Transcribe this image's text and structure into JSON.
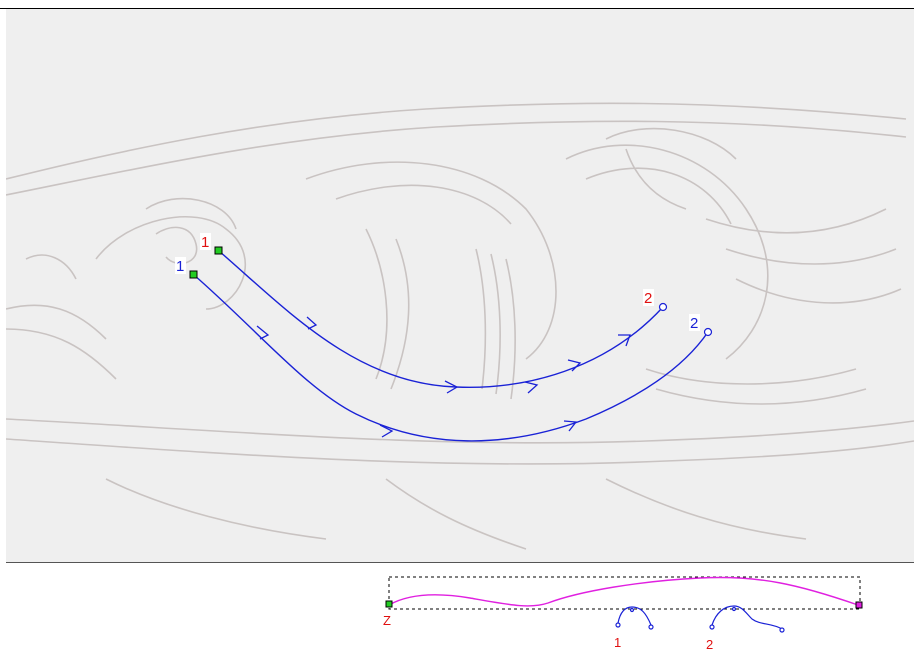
{
  "colors": {
    "path": "#1a22d6",
    "label_red": "#e01010",
    "label_blue": "#1a22d6",
    "handle_fill": "#22cc22",
    "timing_curve": "#e020e0",
    "sketch": "#b8b0ae"
  },
  "paths": [
    {
      "start_label": "1",
      "end_label": "2",
      "start_color": "red"
    },
    {
      "start_label": "1",
      "end_label": "2",
      "start_color": "blue"
    }
  ],
  "timeline": {
    "start_label": "Z",
    "key_labels": [
      "1",
      "2"
    ]
  }
}
